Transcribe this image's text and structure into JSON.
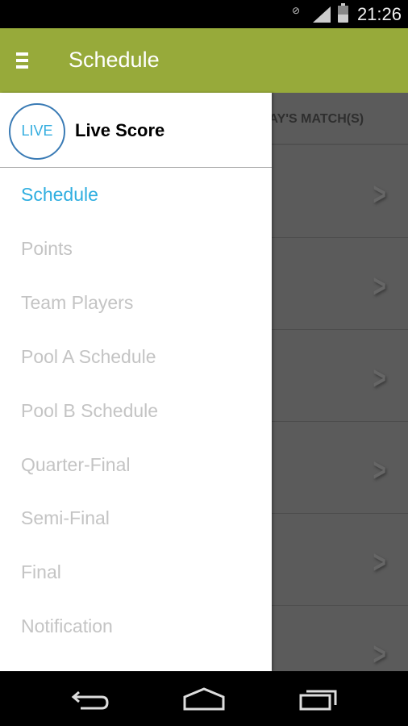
{
  "status_bar": {
    "time": "21:26"
  },
  "app_bar": {
    "title": "Schedule"
  },
  "content": {
    "tab_header": "TODAY'S MATCH(S)",
    "rows": 6
  },
  "drawer": {
    "header": {
      "badge": "LIVE",
      "label": "Live Score"
    },
    "items": [
      {
        "label": "Schedule",
        "active": true
      },
      {
        "label": "Points"
      },
      {
        "label": "Team Players"
      },
      {
        "label": "Pool A Schedule"
      },
      {
        "label": "Pool B Schedule"
      },
      {
        "label": "Quarter-Final"
      },
      {
        "label": "Semi-Final"
      },
      {
        "label": "Final"
      },
      {
        "label": "Notification"
      }
    ]
  },
  "colors": {
    "app_bar": "#97aa3a",
    "active_item": "#2eaee0",
    "inactive_item": "#c4c4c4",
    "live_ring": "#3a7bb5"
  }
}
